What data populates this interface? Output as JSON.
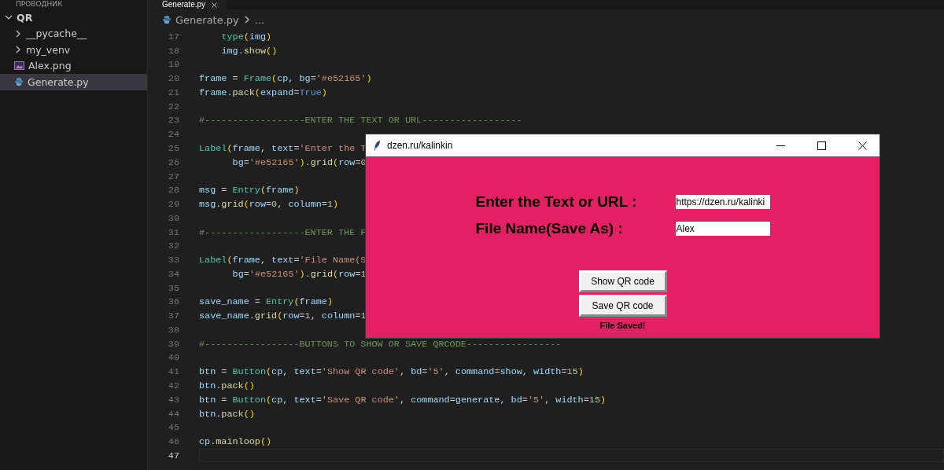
{
  "sidebar": {
    "header": "ПРОВОДНИК",
    "items": [
      {
        "label": "QR",
        "kind": "folder",
        "expanded": true,
        "selected": false,
        "children": [
          {
            "label": "__pycache__",
            "kind": "folder",
            "expanded": false,
            "selected": false
          },
          {
            "label": "my_venv",
            "kind": "folder",
            "expanded": false,
            "selected": false
          },
          {
            "label": "Alex.png",
            "kind": "image",
            "selected": false
          },
          {
            "label": "Generate.py",
            "kind": "python",
            "selected": true
          }
        ]
      }
    ]
  },
  "editor": {
    "tabs": [
      {
        "label": "Generate.py",
        "selected": true
      }
    ],
    "breadcrumb": [
      "Generate.py",
      "..."
    ],
    "lines": [
      {
        "number": "17",
        "current": false,
        "kind": "body",
        "tokens": [
          {
            "kind": "builtin",
            "text": "type"
          },
          {
            "kind": "bracket",
            "text": "("
          },
          {
            "kind": "variable",
            "text": "img"
          },
          {
            "kind": "bracket",
            "text": ")"
          }
        ]
      },
      {
        "number": "18",
        "current": false,
        "kind": "body",
        "tokens": [
          {
            "kind": "variable",
            "text": "img"
          },
          {
            "kind": "plain",
            "text": "."
          },
          {
            "kind": "method",
            "text": "show"
          },
          {
            "kind": "bracket",
            "text": "()"
          }
        ]
      },
      {
        "number": "19",
        "current": false
      },
      {
        "number": "20",
        "current": false,
        "kind": "top",
        "tokens": [
          {
            "kind": "variable",
            "text": "frame"
          },
          {
            "kind": "plain",
            "text": " = "
          },
          {
            "kind": "builtin",
            "text": "Frame"
          },
          {
            "kind": "bracket",
            "text": "("
          },
          {
            "kind": "variable",
            "text": "cp"
          },
          {
            "kind": "plain",
            "text": ", "
          },
          {
            "kind": "variable",
            "text": "bg"
          },
          {
            "kind": "plain",
            "text": "="
          },
          {
            "kind": "string",
            "text": "'#e52165'"
          },
          {
            "kind": "bracket",
            "text": ")"
          }
        ]
      },
      {
        "number": "21",
        "current": false,
        "kind": "top",
        "tokens": [
          {
            "kind": "variable",
            "text": "frame"
          },
          {
            "kind": "plain",
            "text": "."
          },
          {
            "kind": "method",
            "text": "pack"
          },
          {
            "kind": "bracket",
            "text": "("
          },
          {
            "kind": "variable",
            "text": "expand"
          },
          {
            "kind": "plain",
            "text": "="
          },
          {
            "kind": "constant",
            "text": "True"
          },
          {
            "kind": "bracket",
            "text": ")"
          }
        ]
      },
      {
        "number": "22",
        "current": false
      },
      {
        "number": "23",
        "current": false,
        "kind": "top",
        "tokens": [
          {
            "kind": "comment",
            "text": "#------------------ENTER THE TEXT OR URL------------------"
          }
        ]
      },
      {
        "number": "24",
        "current": false
      },
      {
        "number": "25",
        "current": false,
        "kind": "top",
        "tokens": [
          {
            "kind": "builtin",
            "text": "Label"
          },
          {
            "kind": "bracket",
            "text": "("
          },
          {
            "kind": "variable",
            "text": "frame"
          },
          {
            "kind": "plain",
            "text": ", "
          },
          {
            "kind": "variable",
            "text": "text"
          },
          {
            "kind": "plain",
            "text": "="
          },
          {
            "kind": "string",
            "text": "'Enter the T"
          }
        ]
      },
      {
        "number": "26",
        "current": false,
        "kind": "continuation",
        "tokens": [
          {
            "kind": "variable",
            "text": "bg"
          },
          {
            "kind": "plain",
            "text": "="
          },
          {
            "kind": "string",
            "text": "'#e52165'"
          },
          {
            "kind": "bracket",
            "text": ")"
          },
          {
            "kind": "plain",
            "text": "."
          },
          {
            "kind": "method",
            "text": "grid"
          },
          {
            "kind": "bracket",
            "text": "("
          },
          {
            "kind": "variable",
            "text": "row"
          },
          {
            "kind": "plain",
            "text": "="
          },
          {
            "kind": "number",
            "text": "0"
          }
        ]
      },
      {
        "number": "27",
        "current": false
      },
      {
        "number": "28",
        "current": false,
        "kind": "top",
        "tokens": [
          {
            "kind": "variable",
            "text": "msg"
          },
          {
            "kind": "plain",
            "text": " = "
          },
          {
            "kind": "builtin",
            "text": "Entry"
          },
          {
            "kind": "bracket",
            "text": "("
          },
          {
            "kind": "variable",
            "text": "frame"
          },
          {
            "kind": "bracket",
            "text": ")"
          }
        ]
      },
      {
        "number": "29",
        "current": false,
        "kind": "top",
        "tokens": [
          {
            "kind": "variable",
            "text": "msg"
          },
          {
            "kind": "plain",
            "text": "."
          },
          {
            "kind": "method",
            "text": "grid"
          },
          {
            "kind": "bracket",
            "text": "("
          },
          {
            "kind": "variable",
            "text": "row"
          },
          {
            "kind": "plain",
            "text": "="
          },
          {
            "kind": "number",
            "text": "0"
          },
          {
            "kind": "plain",
            "text": ", "
          },
          {
            "kind": "variable",
            "text": "column"
          },
          {
            "kind": "plain",
            "text": "="
          },
          {
            "kind": "number",
            "text": "1"
          },
          {
            "kind": "bracket",
            "text": ")"
          }
        ]
      },
      {
        "number": "30",
        "current": false
      },
      {
        "number": "31",
        "current": false,
        "kind": "top",
        "tokens": [
          {
            "kind": "comment",
            "text": "#------------------ENTER THE F"
          }
        ]
      },
      {
        "number": "32",
        "current": false
      },
      {
        "number": "33",
        "current": false,
        "kind": "top",
        "tokens": [
          {
            "kind": "builtin",
            "text": "Label"
          },
          {
            "kind": "bracket",
            "text": "("
          },
          {
            "kind": "variable",
            "text": "frame"
          },
          {
            "kind": "plain",
            "text": ", "
          },
          {
            "kind": "variable",
            "text": "text"
          },
          {
            "kind": "plain",
            "text": "="
          },
          {
            "kind": "string",
            "text": "'File Name(S"
          }
        ]
      },
      {
        "number": "34",
        "current": false,
        "kind": "continuation",
        "tokens": [
          {
            "kind": "variable",
            "text": "bg"
          },
          {
            "kind": "plain",
            "text": "="
          },
          {
            "kind": "string",
            "text": "'#e52165'"
          },
          {
            "kind": "bracket",
            "text": ")"
          },
          {
            "kind": "plain",
            "text": "."
          },
          {
            "kind": "method",
            "text": "grid"
          },
          {
            "kind": "bracket",
            "text": "("
          },
          {
            "kind": "variable",
            "text": "row"
          },
          {
            "kind": "plain",
            "text": "="
          },
          {
            "kind": "number",
            "text": "1"
          }
        ]
      },
      {
        "number": "35",
        "current": false
      },
      {
        "number": "36",
        "current": false,
        "kind": "top",
        "tokens": [
          {
            "kind": "variable",
            "text": "save_name"
          },
          {
            "kind": "plain",
            "text": " = "
          },
          {
            "kind": "builtin",
            "text": "Entry"
          },
          {
            "kind": "bracket",
            "text": "("
          },
          {
            "kind": "variable",
            "text": "frame"
          },
          {
            "kind": "bracket",
            "text": ")"
          }
        ]
      },
      {
        "number": "37",
        "current": false,
        "kind": "top",
        "tokens": [
          {
            "kind": "variable",
            "text": "save_name"
          },
          {
            "kind": "plain",
            "text": "."
          },
          {
            "kind": "method",
            "text": "grid"
          },
          {
            "kind": "bracket",
            "text": "("
          },
          {
            "kind": "variable",
            "text": "row"
          },
          {
            "kind": "plain",
            "text": "="
          },
          {
            "kind": "number",
            "text": "1"
          },
          {
            "kind": "plain",
            "text": ", "
          },
          {
            "kind": "variable",
            "text": "column"
          },
          {
            "kind": "plain",
            "text": "="
          },
          {
            "kind": "number",
            "text": "1"
          }
        ]
      },
      {
        "number": "38",
        "current": false
      },
      {
        "number": "39",
        "current": false,
        "kind": "top",
        "tokens": [
          {
            "kind": "comment",
            "text": "#-----------------BUTTONS TO SHOW OR SAVE QRCODE-----------------"
          }
        ]
      },
      {
        "number": "40",
        "current": false
      },
      {
        "number": "41",
        "current": false,
        "kind": "top",
        "tokens": [
          {
            "kind": "variable",
            "text": "btn"
          },
          {
            "kind": "plain",
            "text": " = "
          },
          {
            "kind": "builtin",
            "text": "Button"
          },
          {
            "kind": "bracket",
            "text": "("
          },
          {
            "kind": "variable",
            "text": "cp"
          },
          {
            "kind": "plain",
            "text": ", "
          },
          {
            "kind": "variable",
            "text": "text"
          },
          {
            "kind": "plain",
            "text": "="
          },
          {
            "kind": "string",
            "text": "'Show QR code'"
          },
          {
            "kind": "plain",
            "text": ", "
          },
          {
            "kind": "variable",
            "text": "bd"
          },
          {
            "kind": "plain",
            "text": "="
          },
          {
            "kind": "string",
            "text": "'5'"
          },
          {
            "kind": "plain",
            "text": ", "
          },
          {
            "kind": "variable",
            "text": "command"
          },
          {
            "kind": "plain",
            "text": "="
          },
          {
            "kind": "variable",
            "text": "show"
          },
          {
            "kind": "plain",
            "text": ", "
          },
          {
            "kind": "variable",
            "text": "width"
          },
          {
            "kind": "plain",
            "text": "="
          },
          {
            "kind": "number",
            "text": "15"
          },
          {
            "kind": "bracket",
            "text": ")"
          }
        ]
      },
      {
        "number": "42",
        "current": false,
        "kind": "top",
        "tokens": [
          {
            "kind": "variable",
            "text": "btn"
          },
          {
            "kind": "plain",
            "text": "."
          },
          {
            "kind": "method",
            "text": "pack"
          },
          {
            "kind": "bracket",
            "text": "()"
          }
        ]
      },
      {
        "number": "43",
        "current": false,
        "kind": "top",
        "tokens": [
          {
            "kind": "variable",
            "text": "btn"
          },
          {
            "kind": "plain",
            "text": " = "
          },
          {
            "kind": "builtin",
            "text": "Button"
          },
          {
            "kind": "bracket",
            "text": "("
          },
          {
            "kind": "variable",
            "text": "cp"
          },
          {
            "kind": "plain",
            "text": ", "
          },
          {
            "kind": "variable",
            "text": "text"
          },
          {
            "kind": "plain",
            "text": "="
          },
          {
            "kind": "string",
            "text": "'Save QR code'"
          },
          {
            "kind": "plain",
            "text": ", "
          },
          {
            "kind": "variable",
            "text": "command"
          },
          {
            "kind": "plain",
            "text": "="
          },
          {
            "kind": "variable",
            "text": "generate"
          },
          {
            "kind": "plain",
            "text": ", "
          },
          {
            "kind": "variable",
            "text": "bd"
          },
          {
            "kind": "plain",
            "text": "="
          },
          {
            "kind": "string",
            "text": "'5'"
          },
          {
            "kind": "plain",
            "text": ", "
          },
          {
            "kind": "variable",
            "text": "width"
          },
          {
            "kind": "plain",
            "text": "="
          },
          {
            "kind": "number",
            "text": "15"
          },
          {
            "kind": "bracket",
            "text": ")"
          }
        ]
      },
      {
        "number": "44",
        "current": false,
        "kind": "top",
        "tokens": [
          {
            "kind": "variable",
            "text": "btn"
          },
          {
            "kind": "plain",
            "text": "."
          },
          {
            "kind": "method",
            "text": "pack"
          },
          {
            "kind": "bracket",
            "text": "()"
          }
        ]
      },
      {
        "number": "45",
        "current": false
      },
      {
        "number": "46",
        "current": false,
        "kind": "top",
        "tokens": [
          {
            "kind": "variable",
            "text": "cp"
          },
          {
            "kind": "plain",
            "text": "."
          },
          {
            "kind": "method",
            "text": "mainloop"
          },
          {
            "kind": "bracket",
            "text": "()"
          }
        ]
      },
      {
        "number": "47",
        "current": true
      }
    ]
  },
  "app_window": {
    "title": "dzen.ru/kalinkin",
    "fields": [
      {
        "label": "Enter the Text or URL :",
        "value": "https://dzen.ru/kalinki"
      },
      {
        "label": "File Name(Save As) :",
        "value": "Alex"
      }
    ],
    "buttons": [
      "Show QR code",
      "Save QR code"
    ],
    "status": "File Saved!"
  }
}
